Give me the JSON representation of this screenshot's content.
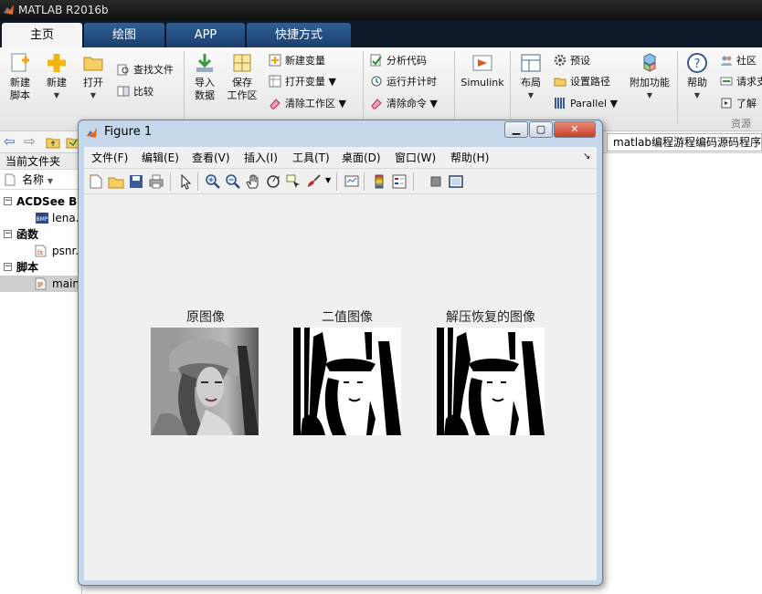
{
  "app": {
    "title": "MATLAB R2016b"
  },
  "tabs": [
    {
      "label": "主页",
      "active": true
    },
    {
      "label": "绘图",
      "active": false
    },
    {
      "label": "APP",
      "active": false
    },
    {
      "label": "快捷方式",
      "active": false
    }
  ],
  "ribbon": {
    "new_script": "新建\n脚本",
    "new": "新建",
    "open": "打开",
    "find_files": "查找文件",
    "compare": "比较",
    "import_data": "导入\n数据",
    "save_workspace": "保存\n工作区",
    "new_variable": "新建变量",
    "open_variable": "打开变量",
    "clear_workspace": "清除工作区",
    "analyze_code": "分析代码",
    "run_and_time": "运行并计时",
    "clear_commands": "清除命令",
    "simulink": "Simulink",
    "layout": "布局",
    "preferences": "预设",
    "set_path": "设置路径",
    "parallel": "Parallel",
    "addons": "附加功能",
    "help": "帮助",
    "community": "社区",
    "request_support": "请求支",
    "learn": "了解",
    "resources_group": "资源"
  },
  "nav": {
    "path": "matlab编程游程编码源码程序"
  },
  "browser": {
    "header": "当前文件夹",
    "col_name": "名称",
    "groups": [
      {
        "label": "ACDSee BMP",
        "items": [
          "lena.bmp"
        ]
      },
      {
        "label": "函数",
        "items": [
          "psnr.m"
        ]
      },
      {
        "label": "脚本",
        "items": [
          "main.m"
        ]
      }
    ]
  },
  "figure": {
    "title": "Figure 1",
    "menu": [
      "文件(F)",
      "编辑(E)",
      "查看(V)",
      "插入(I)",
      "工具(T)",
      "桌面(D)",
      "窗口(W)",
      "帮助(H)"
    ],
    "plots": [
      {
        "title": "原图像"
      },
      {
        "title": "二值图像"
      },
      {
        "title": "解压恢复的图像"
      }
    ]
  },
  "colors": {
    "matlab_orange": "#e16a1f",
    "tab_blue": "#2f5e96",
    "window_frame": "#c5d7ea"
  }
}
